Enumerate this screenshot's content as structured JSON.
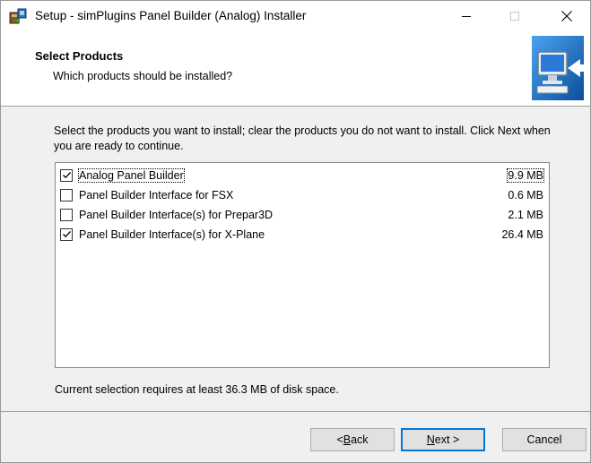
{
  "window": {
    "title": "Setup - simPlugins Panel Builder (Analog) Installer",
    "controls": {
      "minimize": "–",
      "maximize": "□",
      "close": "✕"
    }
  },
  "header": {
    "title": "Select Products",
    "subtitle": "Which products should be installed?"
  },
  "main": {
    "intro": "Select the products you want to install; clear the products you do not want to install. Click Next when you are ready to continue.",
    "products": [
      {
        "label": "Analog Panel Builder",
        "size": "9.9 MB",
        "checked": true
      },
      {
        "label": "Panel Builder Interface for FSX",
        "size": "0.6 MB",
        "checked": false
      },
      {
        "label": "Panel Builder Interface(s) for Prepar3D",
        "size": "2.1 MB",
        "checked": false
      },
      {
        "label": "Panel Builder Interface(s) for X-Plane",
        "size": "26.4 MB",
        "checked": true
      }
    ],
    "status": "Current selection requires at least 36.3 MB of disk space."
  },
  "buttons": {
    "back_prefix": "< ",
    "back_hotkey": "B",
    "back_rest": "ack",
    "next_hotkey": "N",
    "next_rest": "ext >",
    "cancel": "Cancel"
  },
  "colors": {
    "accent": "#0078d7"
  }
}
